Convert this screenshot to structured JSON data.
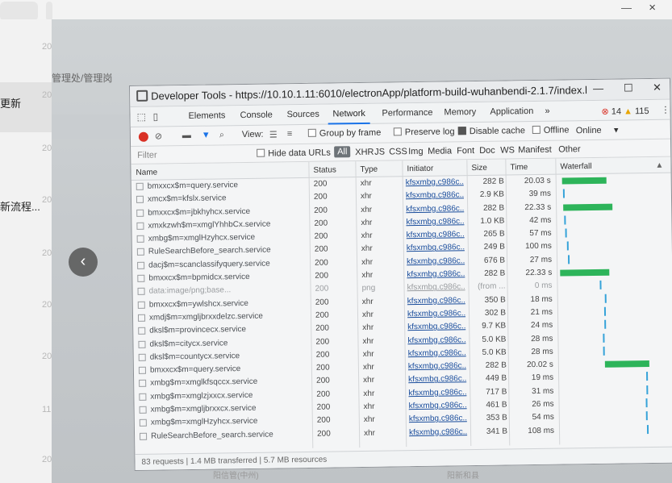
{
  "viewer": {
    "left_items": [
      "更新",
      "新流程..."
    ],
    "year_marks": [
      "20",
      "20",
      "20",
      "20",
      "20",
      "20",
      "20",
      "11",
      "20",
      "20"
    ],
    "window_close": "×",
    "window_min": "—",
    "back_arrow": "‹"
  },
  "background": {
    "breadcrumb": "管理处/管理岗",
    "bottom_left": "阳信管(中州)",
    "bottom_right": "阳新和县"
  },
  "devtools": {
    "title": "Developer Tools - https://10.10.1.11:6010/electronApp/platform-build-wuhanbendi-2.1.7/index.html?sjs=...",
    "window_buttons": [
      "—",
      "☐",
      "✕"
    ],
    "tabs": [
      "Elements",
      "Console",
      "Sources",
      "Network",
      "Performance",
      "Memory",
      "Application",
      "»"
    ],
    "active_tab": "Network",
    "errors": "14",
    "warnings": "115",
    "toolbar": {
      "view_label": "View:",
      "group_by_frame": "Group by frame",
      "preserve_log": "Preserve log",
      "disable_cache": "Disable cache",
      "offline": "Offline",
      "throttle": "Online"
    },
    "filter": {
      "placeholder": "Filter",
      "hide_data_urls": "Hide data URLs",
      "types": [
        "All",
        "XHR",
        "JS",
        "CSS",
        "Img",
        "Media",
        "Font",
        "Doc",
        "WS",
        "Manifest",
        "Other"
      ]
    },
    "columns": [
      "Name",
      "Status",
      "Type",
      "Initiator",
      "Size",
      "Time",
      "Waterfall"
    ],
    "rows": [
      {
        "name": "bmxxcx$m=query.service",
        "status": "200",
        "type": "xhr",
        "initiator": "kfsxmbg.c986c...",
        "size": "282 B",
        "time": "20.03 s",
        "wf": {
          "kind": "bar",
          "start": 0.03,
          "len": 0.45
        }
      },
      {
        "name": "xmcx$m=kfslx.service",
        "status": "200",
        "type": "xhr",
        "initiator": "kfsxmbg.c986c...",
        "size": "2.9 KB",
        "time": "39 ms",
        "wf": {
          "kind": "tick",
          "start": 0.04
        }
      },
      {
        "name": "bmxxcx$m=jbkhyhcx.service",
        "status": "200",
        "type": "xhr",
        "initiator": "kfsxmbg.c986c...",
        "size": "282 B",
        "time": "22.33 s",
        "wf": {
          "kind": "bar",
          "start": 0.04,
          "len": 0.5
        }
      },
      {
        "name": "xmxkzwh$m=xmglYhhbCx.service",
        "status": "200",
        "type": "xhr",
        "initiator": "kfsxmbg.c986c...",
        "size": "1.0 KB",
        "time": "42 ms",
        "wf": {
          "kind": "tick",
          "start": 0.05
        }
      },
      {
        "name": "xmbg$m=xmglHzyhcx.service",
        "status": "200",
        "type": "xhr",
        "initiator": "kfsxmbg.c986c...",
        "size": "265 B",
        "time": "57 ms",
        "wf": {
          "kind": "tick",
          "start": 0.06
        }
      },
      {
        "name": "RuleSearchBefore_search.service",
        "status": "200",
        "type": "xhr",
        "initiator": "kfsxmbg.c986c...",
        "size": "249 B",
        "time": "100 ms",
        "wf": {
          "kind": "tick",
          "start": 0.07
        }
      },
      {
        "name": "dacj$m=scanclassifyquery.service",
        "status": "200",
        "type": "xhr",
        "initiator": "kfsxmbg.c986c...",
        "size": "676 B",
        "time": "27 ms",
        "wf": {
          "kind": "tick",
          "start": 0.08
        }
      },
      {
        "name": "bmxxcx$m=bpmidcx.service",
        "status": "200",
        "type": "xhr",
        "initiator": "kfsxmbg.c986c...",
        "size": "282 B",
        "time": "22.33 s",
        "wf": {
          "kind": "bar",
          "start": 0.0,
          "len": 0.5
        }
      },
      {
        "name": "data:image/png;base...",
        "status": "200",
        "type": "png",
        "initiator": "kfsxmbg.c986c...",
        "size": "(from ...",
        "time": "0 ms",
        "wf": {
          "kind": "tick",
          "start": 0.4
        },
        "faint": true
      },
      {
        "name": "bmxxcx$m=ywlshcx.service",
        "status": "200",
        "type": "xhr",
        "initiator": "kfsxmbg.c986c...",
        "size": "350 B",
        "time": "18 ms",
        "wf": {
          "kind": "tick",
          "start": 0.45
        }
      },
      {
        "name": "xmdj$m=xmgljbrxxdelzc.service",
        "status": "200",
        "type": "xhr",
        "initiator": "kfsxmbg.c986c...",
        "size": "302 B",
        "time": "21 ms",
        "wf": {
          "kind": "tick",
          "start": 0.44
        }
      },
      {
        "name": "dksl$m=provincecx.service",
        "status": "200",
        "type": "xhr",
        "initiator": "kfsxmbg.c986c...",
        "size": "9.7 KB",
        "time": "24 ms",
        "wf": {
          "kind": "tick",
          "start": 0.44
        }
      },
      {
        "name": "dksl$m=citycx.service",
        "status": "200",
        "type": "xhr",
        "initiator": "kfsxmbg.c986c...",
        "size": "5.0 KB",
        "time": "28 ms",
        "wf": {
          "kind": "tick",
          "start": 0.43
        }
      },
      {
        "name": "dksl$m=countycx.service",
        "status": "200",
        "type": "xhr",
        "initiator": "kfsxmbg.c986c...",
        "size": "5.0 KB",
        "time": "28 ms",
        "wf": {
          "kind": "tick",
          "start": 0.43
        }
      },
      {
        "name": "bmxxcx$m=query.service",
        "status": "200",
        "type": "xhr",
        "initiator": "kfsxmbg.c986c...",
        "size": "282 B",
        "time": "20.02 s",
        "wf": {
          "kind": "bar",
          "start": 0.44,
          "len": 0.45
        }
      },
      {
        "name": "xmbg$m=xmglkfsqccx.service",
        "status": "200",
        "type": "xhr",
        "initiator": "kfsxmbg.c986c...",
        "size": "449 B",
        "time": "19 ms",
        "wf": {
          "kind": "tick",
          "start": 0.86
        }
      },
      {
        "name": "xmbg$m=xmglzjxxcx.service",
        "status": "200",
        "type": "xhr",
        "initiator": "kfsxmbg.c986c...",
        "size": "717 B",
        "time": "31 ms",
        "wf": {
          "kind": "tick",
          "start": 0.86
        }
      },
      {
        "name": "xmbg$m=xmgljbrxxcx.service",
        "status": "200",
        "type": "xhr",
        "initiator": "kfsxmbg.c986c...",
        "size": "461 B",
        "time": "26 ms",
        "wf": {
          "kind": "tick",
          "start": 0.85
        }
      },
      {
        "name": "xmbg$m=xmglHzyhcx.service",
        "status": "200",
        "type": "xhr",
        "initiator": "kfsxmbg.c986c...",
        "size": "353 B",
        "time": "54 ms",
        "wf": {
          "kind": "tick",
          "start": 0.85
        }
      },
      {
        "name": "RuleSearchBefore_search.service",
        "status": "200",
        "type": "xhr",
        "initiator": "kfsxmbg.c986c...",
        "size": "341 B",
        "time": "108 ms",
        "wf": {
          "kind": "tick",
          "start": 0.86
        }
      }
    ],
    "status": "83 requests | 1.4 MB transferred | 5.7 MB resources",
    "colors": {
      "record": "#d93025",
      "waterfall_bar": "#2db45a",
      "waterfall_tick": "#36a3d9",
      "active_tab": "#1a73e8"
    }
  }
}
